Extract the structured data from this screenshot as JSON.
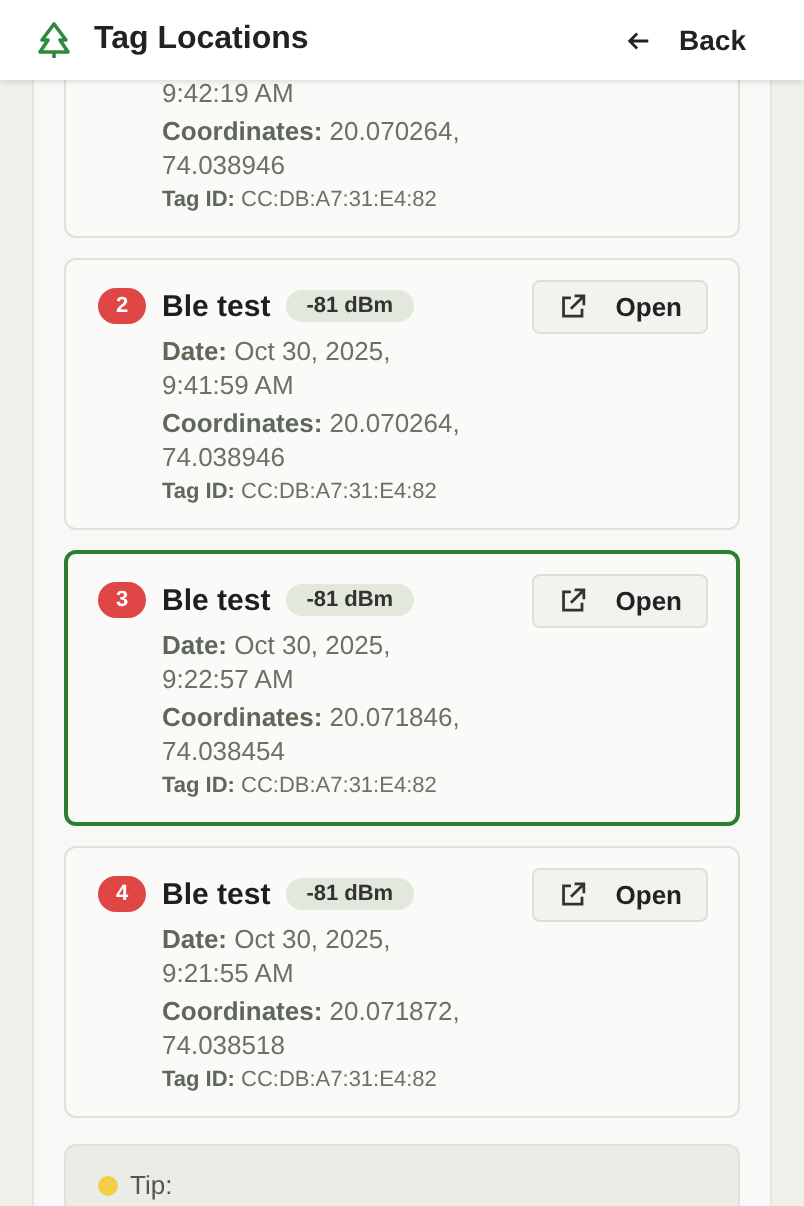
{
  "header": {
    "title": "Tag Locations",
    "back": "Back"
  },
  "locations": [
    {
      "kind": "partial",
      "selected": false,
      "time_tail": "9:42:19 AM",
      "coordinates_label": "Coordinates:",
      "coordinates": "20.070264, 74.038946",
      "tag_label": "Tag ID:",
      "tag_id": "CC:DB:A7:31:E4:82"
    },
    {
      "kind": "full",
      "selected": false,
      "index": "2",
      "name": "Ble test",
      "rssi": "-81 dBm",
      "open": "Open",
      "date_label": "Date:",
      "date": "Oct 30, 2025, 9:41:59 AM",
      "coordinates_label": "Coordinates:",
      "coordinates": "20.070264, 74.038946",
      "tag_label": "Tag ID:",
      "tag_id": "CC:DB:A7:31:E4:82"
    },
    {
      "kind": "full",
      "selected": true,
      "index": "3",
      "name": "Ble test",
      "rssi": "-81 dBm",
      "open": "Open",
      "date_label": "Date:",
      "date": "Oct 30, 2025, 9:22:57 AM",
      "coordinates_label": "Coordinates:",
      "coordinates": "20.071846, 74.038454",
      "tag_label": "Tag ID:",
      "tag_id": "CC:DB:A7:31:E4:82"
    },
    {
      "kind": "full",
      "selected": false,
      "index": "4",
      "name": "Ble test",
      "rssi": "-81 dBm",
      "open": "Open",
      "date_label": "Date:",
      "date": "Oct 30, 2025, 9:21:55 AM",
      "coordinates_label": "Coordinates:",
      "coordinates": "20.071872, 74.038518",
      "tag_label": "Tag ID:",
      "tag_id": "CC:DB:A7:31:E4:82"
    }
  ],
  "tip": {
    "title": "Tip:"
  }
}
